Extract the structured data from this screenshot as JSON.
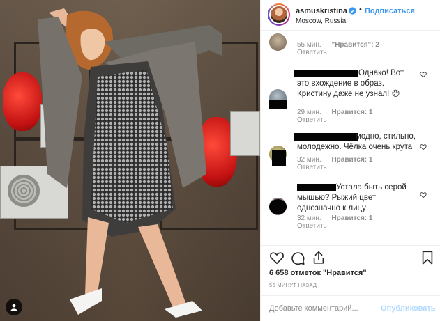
{
  "post": {
    "username": "asmuskristina",
    "follow_label": "Подписаться",
    "separator": "•",
    "location": "Moscow, Russia"
  },
  "comments": [
    {
      "text": "",
      "time": "55 мин.",
      "likes": "\"Нравится\": 2",
      "reply": "Ответить"
    },
    {
      "text": "Однако! Вот это вхождение в образ. Кристину даже не узнал! 😊",
      "time": "29 мин.",
      "likes": "Нравится: 1",
      "reply": "Ответить"
    },
    {
      "text": "модно, стильно, молодежно. Чёлка очень крута",
      "time": "32 мин.",
      "likes": "Нравится: 1",
      "reply": "Ответить"
    },
    {
      "text": "Устала быть серой мышью? Рыжий цвет однозначно к лицу",
      "time": "32 мин.",
      "likes": "Нравится: 1",
      "reply": "Ответить"
    }
  ],
  "actions": {
    "likes_count": "6 658 отметок \"Нравится\"",
    "time_ago": "56 МИНУТ НАЗАД",
    "comment_placeholder": "Добавьте комментарий...",
    "publish_label": "Опубликовать"
  },
  "colors": {
    "link_blue": "#3897f0",
    "publish_disabled": "#b3dbff",
    "muted": "#8e8e8e"
  },
  "icons": [
    "user-tag-icon",
    "verified-icon",
    "heart-icon",
    "comment-icon",
    "share-icon",
    "bookmark-icon"
  ]
}
